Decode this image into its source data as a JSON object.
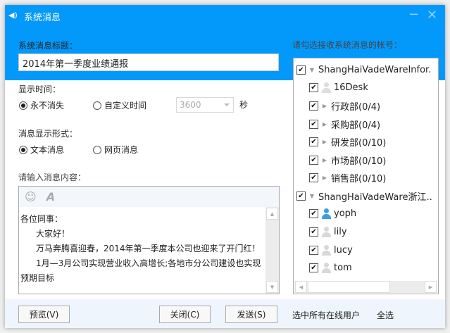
{
  "window": {
    "title": "系统消息",
    "minimize": "−",
    "close": "✕"
  },
  "form": {
    "title_label": "系统消息标题：",
    "title_value": "2014年第一季度业绩通报",
    "time_label": "显示时间：",
    "time_options": [
      {
        "label": "永不消失",
        "selected": true
      },
      {
        "label": "自定义时间",
        "selected": false
      }
    ],
    "time_value": "3600",
    "time_unit": "秒",
    "format_label": "消息显示形式：",
    "format_options": [
      {
        "label": "文本消息",
        "selected": true
      },
      {
        "label": "网页消息",
        "selected": false
      }
    ],
    "content_label": "请输入消息内容：",
    "content_lines": [
      "各位同事：",
      "大家好！",
      "万马奔腾喜迎春，2014年第一季度本公司也迎来了开门红！",
      "1月—3月公司实现营业收入高增长;各地市分公司建设也实现",
      "预期目标"
    ]
  },
  "recipients": {
    "label": "请勾选接收系统消息的帐号：",
    "nodes": [
      {
        "label": "ShangHaiVadeWareInfor.",
        "checked": true
      },
      {
        "label": "16Desk",
        "checked": true
      },
      {
        "label": "行政部(0/4)",
        "checked": true
      },
      {
        "label": "采购部(0/4)",
        "checked": true
      },
      {
        "label": "研发部(0/10)",
        "checked": true
      },
      {
        "label": "市场部(0/10)",
        "checked": true
      },
      {
        "label": "销售部(0/10)",
        "checked": true
      },
      {
        "label": "ShangHaiVadeWare浙江..",
        "checked": true
      },
      {
        "label": "yoph",
        "checked": true
      },
      {
        "label": "lily",
        "checked": true
      },
      {
        "label": "lucy",
        "checked": true
      },
      {
        "label": "tom",
        "checked": true
      }
    ]
  },
  "footer": {
    "preview": "预览(V)",
    "close": "关闭(C)",
    "send": "发送(S)",
    "select_online": "选中所有在线用户",
    "select_all": "全选"
  },
  "colors": {
    "header": "#0399fb",
    "footer": "#eef5fc",
    "online_user": "#3a9be6",
    "offline_user": "#d8d8d8"
  }
}
